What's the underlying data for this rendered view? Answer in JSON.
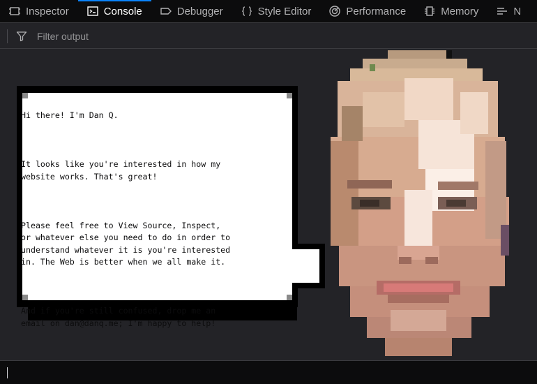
{
  "toolbar": {
    "tabs": [
      {
        "label": "Inspector",
        "icon": "inspector-icon",
        "selected": false
      },
      {
        "label": "Console",
        "icon": "console-icon",
        "selected": true
      },
      {
        "label": "Debugger",
        "icon": "debugger-icon",
        "selected": false
      },
      {
        "label": "Style Editor",
        "icon": "style-editor-icon",
        "selected": false
      },
      {
        "label": "Performance",
        "icon": "performance-icon",
        "selected": false
      },
      {
        "label": "Memory",
        "icon": "memory-icon",
        "selected": false
      },
      {
        "label": "N",
        "icon": "network-icon",
        "selected": false
      }
    ]
  },
  "filter": {
    "placeholder": "Filter output",
    "icon": "filter-icon"
  },
  "console": {
    "message": {
      "paragraphs": [
        "Hi there! I'm Dan Q.",
        "It looks like you're interested in how my\nwebsite works. That's great!",
        "Please feel free to View Source, Inspect,\nor whatever else you need to do in order to\nunderstand whatever it is you're interested\nin. The Web is better when we all make it.",
        "And if you're still confused, drop me an\nemail on dan@danq.me; I'm happy to help!"
      ]
    },
    "avatar": "pixelated-face"
  },
  "colors": {
    "background": "#232327",
    "toolbar": "#0c0c0d",
    "accent": "#0a84ff",
    "text": "#d7d7db"
  }
}
